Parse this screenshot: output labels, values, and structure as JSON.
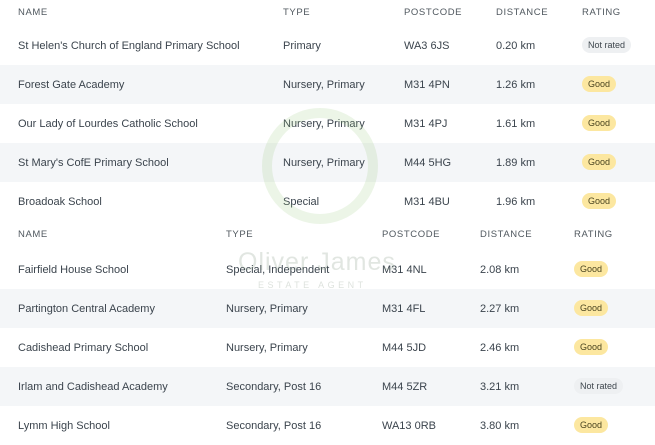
{
  "table1": {
    "headers": {
      "name": "NAME",
      "type": "TYPE",
      "postcode": "POSTCODE",
      "distance": "DISTANCE",
      "rating": "RATING"
    },
    "rows": [
      {
        "name": "St Helen's Church of England Primary School",
        "type": "Primary",
        "postcode": "WA3 6JS",
        "distance": "0.20 km",
        "rating": "Not rated"
      },
      {
        "name": "Forest Gate Academy",
        "type": "Nursery, Primary",
        "postcode": "M31 4PN",
        "distance": "1.26 km",
        "rating": "Good"
      },
      {
        "name": "Our Lady of Lourdes Catholic School",
        "type": "Nursery, Primary",
        "postcode": "M31 4PJ",
        "distance": "1.61 km",
        "rating": "Good"
      },
      {
        "name": "St Mary's CofE Primary School",
        "type": "Nursery, Primary",
        "postcode": "M44 5HG",
        "distance": "1.89 km",
        "rating": "Good"
      },
      {
        "name": "Broadoak School",
        "type": "Special",
        "postcode": "M31 4BU",
        "distance": "1.96 km",
        "rating": "Good"
      }
    ]
  },
  "table2": {
    "headers": {
      "name": "NAME",
      "type": "TYPE",
      "postcode": "POSTCODE",
      "distance": "DISTANCE",
      "rating": "RATING"
    },
    "rows": [
      {
        "name": "Fairfield House School",
        "type": "Special, Independent",
        "postcode": "M31 4NL",
        "distance": "2.08 km",
        "rating": "Good"
      },
      {
        "name": "Partington Central Academy",
        "type": "Nursery, Primary",
        "postcode": "M31 4FL",
        "distance": "2.27 km",
        "rating": "Good"
      },
      {
        "name": "Cadishead Primary School",
        "type": "Nursery, Primary",
        "postcode": "M44 5JD",
        "distance": "2.46 km",
        "rating": "Good"
      },
      {
        "name": "Irlam and Cadishead Academy",
        "type": "Secondary, Post 16",
        "postcode": "M44 5ZR",
        "distance": "3.21 km",
        "rating": "Not rated"
      },
      {
        "name": "Lymm High School",
        "type": "Secondary, Post 16",
        "postcode": "WA13 0RB",
        "distance": "3.80 km",
        "rating": "Good"
      }
    ]
  },
  "watermark": {
    "brand": "Oliver James",
    "tagline": "ESTATE AGENT"
  },
  "colors": {
    "good_badge": "#fce7a0",
    "not_rated_badge": "#eef0f2",
    "stripe": "#f4f6f8"
  }
}
